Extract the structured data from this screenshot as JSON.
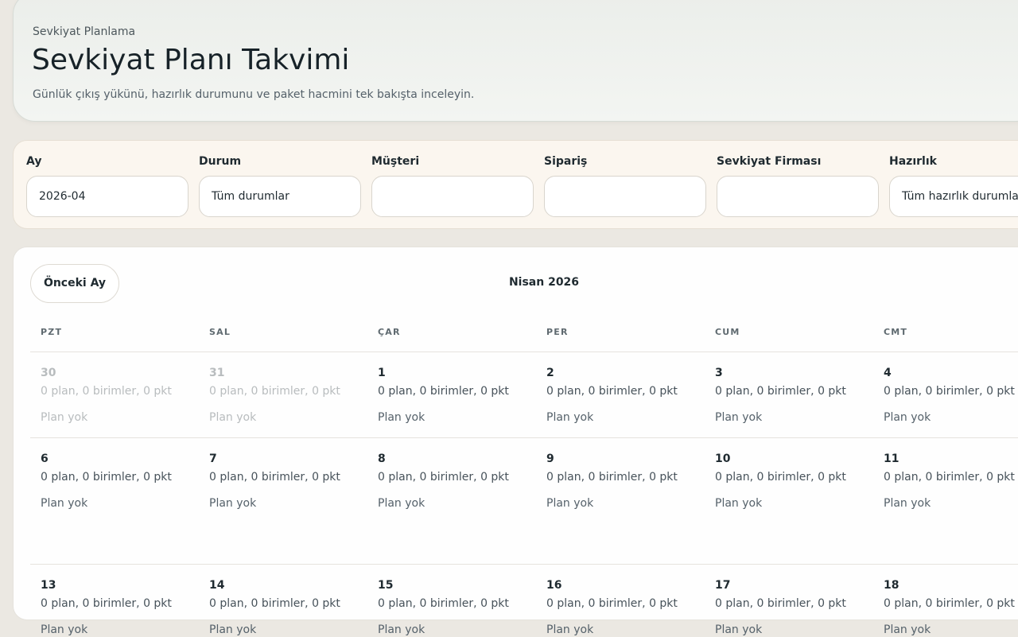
{
  "header": {
    "eyebrow": "Sevkiyat Planlama",
    "title": "Sevkiyat Planı Takvimi",
    "subtitle": "Günlük çıkış yükünü, hazırlık durumunu ve paket hacmini tek bakışta inceleyin."
  },
  "filters": [
    {
      "label": "Ay",
      "value": "2026-04"
    },
    {
      "label": "Durum",
      "value": "Tüm durumlar"
    },
    {
      "label": "Müşteri",
      "value": ""
    },
    {
      "label": "Sipariş",
      "value": ""
    },
    {
      "label": "Sevkiyat Firması",
      "value": ""
    },
    {
      "label": "Hazırlık",
      "value": "Tüm hazırlık durumları"
    }
  ],
  "calendar": {
    "prev_label": "Önceki Ay",
    "month_title": "Nisan 2026",
    "weekdays": [
      "PZT",
      "SAL",
      "ÇAR",
      "PER",
      "CUM",
      "CMT"
    ],
    "weeks": [
      [
        {
          "day": "30",
          "summary": "0 plan, 0 birimler, 0 pkt",
          "status": "Plan yok",
          "muted": true
        },
        {
          "day": "31",
          "summary": "0 plan, 0 birimler, 0 pkt",
          "status": "Plan yok",
          "muted": true
        },
        {
          "day": "1",
          "summary": "0 plan, 0 birimler, 0 pkt",
          "status": "Plan yok"
        },
        {
          "day": "2",
          "summary": "0 plan, 0 birimler, 0 pkt",
          "status": "Plan yok"
        },
        {
          "day": "3",
          "summary": "0 plan, 0 birimler, 0 pkt",
          "status": "Plan yok"
        },
        {
          "day": "4",
          "summary": "0 plan, 0 birimler, 0 pkt",
          "status": "Plan yok"
        }
      ],
      [
        {
          "day": "6",
          "summary": "0 plan, 0 birimler, 0 pkt",
          "status": "Plan yok"
        },
        {
          "day": "7",
          "summary": "0 plan, 0 birimler, 0 pkt",
          "status": "Plan yok"
        },
        {
          "day": "8",
          "summary": "0 plan, 0 birimler, 0 pkt",
          "status": "Plan yok"
        },
        {
          "day": "9",
          "summary": "0 plan, 0 birimler, 0 pkt",
          "status": "Plan yok"
        },
        {
          "day": "10",
          "summary": "0 plan, 0 birimler, 0 pkt",
          "status": "Plan yok"
        },
        {
          "day": "11",
          "summary": "0 plan, 0 birimler, 0 pkt",
          "status": "Plan yok"
        }
      ],
      [
        {
          "day": "13",
          "summary": "0 plan, 0 birimler, 0 pkt",
          "status": "Plan yok"
        },
        {
          "day": "14",
          "summary": "0 plan, 0 birimler, 0 pkt",
          "status": "Plan yok"
        },
        {
          "day": "15",
          "summary": "0 plan, 0 birimler, 0 pkt",
          "status": "Plan yok"
        },
        {
          "day": "16",
          "summary": "0 plan, 0 birimler, 0 pkt",
          "status": "Plan yok"
        },
        {
          "day": "17",
          "summary": "0 plan, 0 birimler, 0 pkt",
          "status": "Plan yok"
        },
        {
          "day": "18",
          "summary": "0 plan, 0 birimler, 0 pkt",
          "status": "Plan yok"
        }
      ]
    ]
  }
}
